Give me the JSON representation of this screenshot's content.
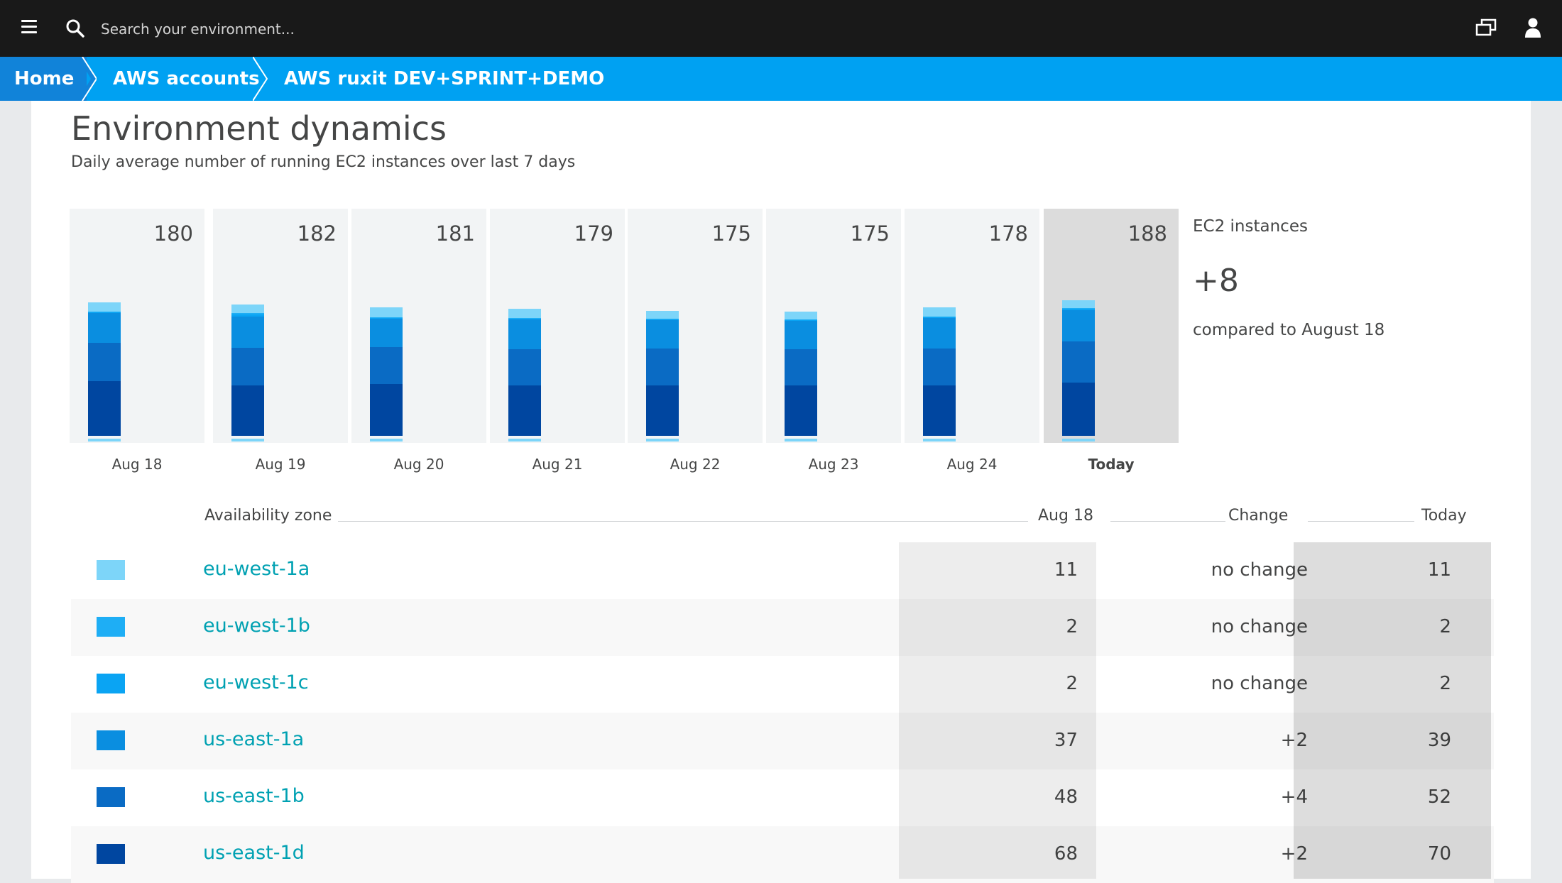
{
  "topbar": {
    "search_placeholder": "Search your environment..."
  },
  "breadcrumb": {
    "items": [
      {
        "label": "Home"
      },
      {
        "label": "AWS accounts"
      },
      {
        "label": "AWS ruxit DEV+SPRINT+DEMO"
      }
    ]
  },
  "page": {
    "title": "Environment dynamics",
    "subtitle": "Daily average number of running EC2 instances over last 7 days"
  },
  "colors": {
    "eu-west-1a": "#7dd5f9",
    "eu-west-1b": "#1eaef5",
    "eu-west-1c": "#0aa4f3",
    "us-east-1a": "#0a8ee0",
    "us-east-1b": "#0a6bc4",
    "us-east-1d": "#0046a0",
    "accent": "#00a1f2",
    "link": "#00a1b2"
  },
  "chart_data": {
    "type": "bar",
    "stacked": true,
    "categories": [
      "Aug 18",
      "Aug 19",
      "Aug 20",
      "Aug 21",
      "Aug 22",
      "Aug 23",
      "Aug 24",
      "Today"
    ],
    "totals": [
      "180",
      "182",
      "181",
      "179",
      "175",
      "175",
      "178",
      "188"
    ],
    "series": [
      {
        "name": "us-east-1d",
        "values": [
          68,
          63,
          65,
          63,
          63,
          63,
          63,
          66
        ]
      },
      {
        "name": "us-east-1b",
        "values": [
          48,
          47,
          46,
          45,
          46,
          45,
          46,
          52
        ]
      },
      {
        "name": "us-east-1a",
        "values": [
          37,
          39,
          35,
          37,
          35,
          35,
          38,
          39
        ]
      },
      {
        "name": "eu-west-1c",
        "values": [
          1,
          2,
          1,
          1,
          1,
          1,
          1,
          1
        ]
      },
      {
        "name": "eu-west-1b",
        "values": [
          1,
          2,
          1,
          1,
          1,
          1,
          1,
          1
        ]
      },
      {
        "name": "eu-west-1a",
        "values": [
          11,
          11,
          12,
          11,
          10,
          10,
          11,
          10
        ]
      }
    ]
  },
  "summary": {
    "label": "EC2 instances",
    "value": "+8",
    "sub": "compared to August 18"
  },
  "table": {
    "headers": {
      "zone": "Availability zone",
      "base": "Aug 18",
      "change": "Change",
      "today": "Today"
    },
    "rows": [
      {
        "zone": "eu-west-1a",
        "base": "11",
        "change": "no change",
        "today": "11"
      },
      {
        "zone": "eu-west-1b",
        "base": "2",
        "change": "no change",
        "today": "2"
      },
      {
        "zone": "eu-west-1c",
        "base": "2",
        "change": "no change",
        "today": "2"
      },
      {
        "zone": "us-east-1a",
        "base": "37",
        "change": "+2",
        "today": "39"
      },
      {
        "zone": "us-east-1b",
        "base": "48",
        "change": "+4",
        "today": "52"
      },
      {
        "zone": "us-east-1d",
        "base": "68",
        "change": "+2",
        "today": "70"
      }
    ]
  }
}
